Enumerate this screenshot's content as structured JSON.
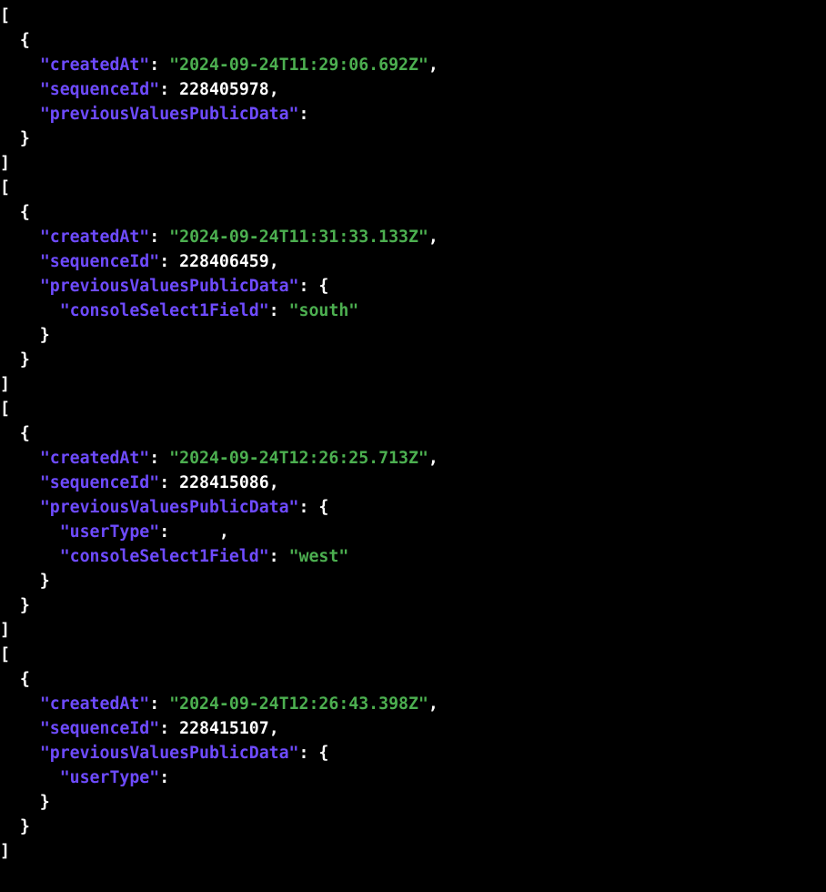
{
  "records": [
    {
      "createdAt": "2024-09-24T11:29:06.692Z",
      "sequenceId": 228405978,
      "previousValuesPublicData": null
    },
    {
      "createdAt": "2024-09-24T11:31:33.133Z",
      "sequenceId": 228406459,
      "previousValuesPublicData": {
        "consoleSelect1Field": "south"
      }
    },
    {
      "createdAt": "2024-09-24T12:26:25.713Z",
      "sequenceId": 228415086,
      "previousValuesPublicData": {
        "userType": null,
        "consoleSelect1Field": "west"
      }
    },
    {
      "createdAt": "2024-09-24T12:26:43.398Z",
      "sequenceId": 228415107,
      "previousValuesPublicData": {
        "userType": null
      }
    }
  ],
  "keys": {
    "createdAt": "\"createdAt\"",
    "sequenceId": "\"sequenceId\"",
    "previousValuesPublicData": "\"previousValuesPublicData\"",
    "consoleSelect1Field": "\"consoleSelect1Field\"",
    "userType": "\"userType\""
  },
  "nullLabel": "null"
}
